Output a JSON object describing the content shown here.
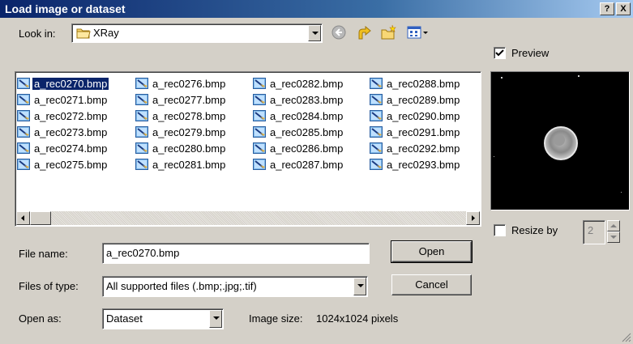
{
  "window": {
    "title": "Load image or dataset",
    "help_label": "?",
    "close_label": "X"
  },
  "look_in": {
    "label": "Look in:",
    "folder": "XRay",
    "folder_icon": "folder-icon"
  },
  "toolbar": {
    "icons": [
      "back-icon",
      "up-folder-icon",
      "new-folder-icon",
      "view-menu-icon"
    ]
  },
  "preview": {
    "label": "Preview",
    "checked": true
  },
  "files": [
    [
      "a_rec0270.bmp",
      "a_rec0271.bmp",
      "a_rec0272.bmp",
      "a_rec0273.bmp",
      "a_rec0274.bmp",
      "a_rec0275.bmp"
    ],
    [
      "a_rec0276.bmp",
      "a_rec0277.bmp",
      "a_rec0278.bmp",
      "a_rec0279.bmp",
      "a_rec0280.bmp",
      "a_rec0281.bmp"
    ],
    [
      "a_rec0282.bmp",
      "a_rec0283.bmp",
      "a_rec0284.bmp",
      "a_rec0285.bmp",
      "a_rec0286.bmp",
      "a_rec0287.bmp"
    ],
    [
      "a_rec0288.bmp",
      "a_rec0289.bmp",
      "a_rec0290.bmp",
      "a_rec0291.bmp",
      "a_rec0292.bmp",
      "a_rec0293.bmp"
    ]
  ],
  "selected_file": "a_rec0270.bmp",
  "file_name": {
    "label": "File name:",
    "value": "a_rec0270.bmp"
  },
  "file_type": {
    "label": "Files of type:",
    "value": "All supported files (.bmp;.jpg;.tif)"
  },
  "open_as": {
    "label": "Open as:",
    "value": "Dataset"
  },
  "image_size": {
    "label": "Image size:",
    "value": "1024x1024 pixels"
  },
  "buttons": {
    "open": "Open",
    "cancel": "Cancel"
  },
  "resize": {
    "label": "Resize by",
    "checked": false,
    "value": "2"
  },
  "colors": {
    "title_start": "#0a246a",
    "title_end": "#a6caf0",
    "selection": "#0a246a",
    "face": "#d4d0c8"
  }
}
